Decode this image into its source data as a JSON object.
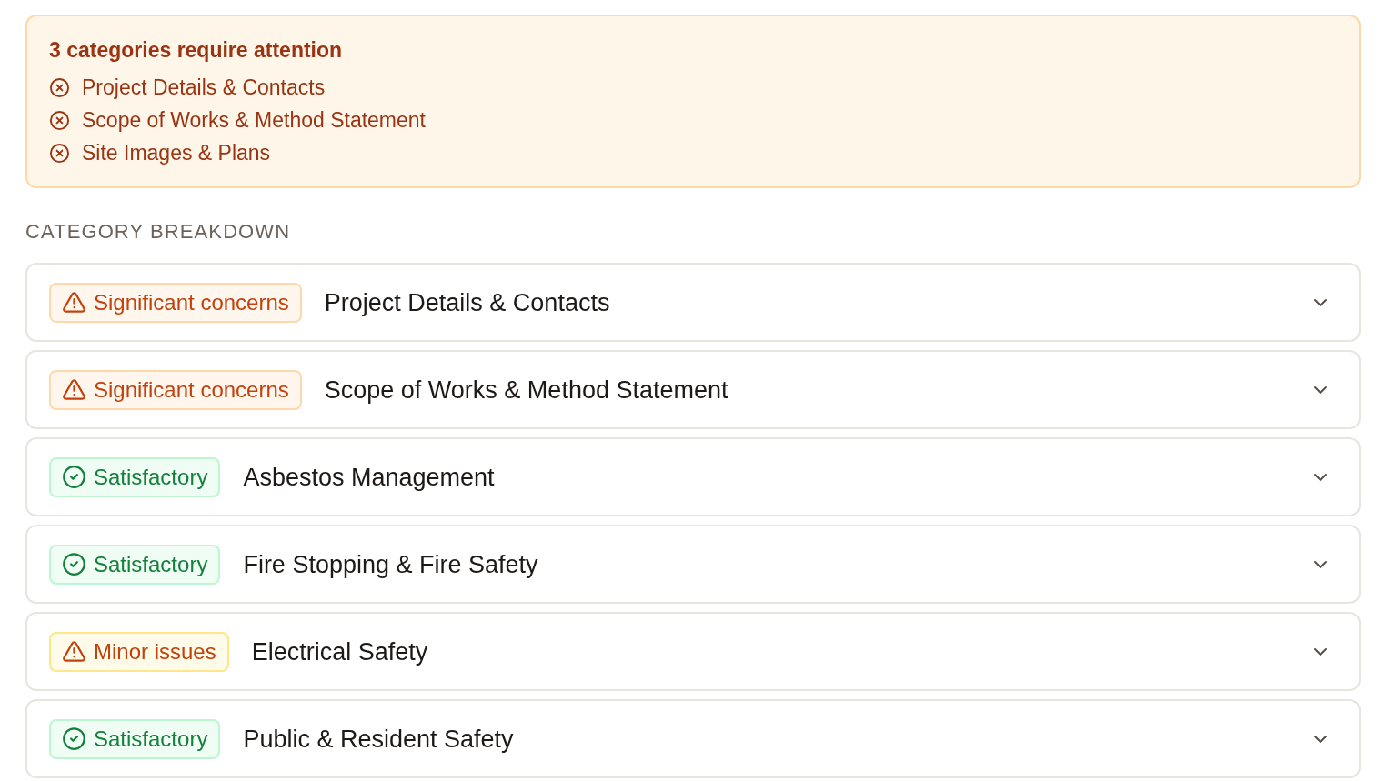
{
  "alert": {
    "title": "3 categories require attention",
    "items": [
      "Project Details & Contacts",
      "Scope of Works & Method Statement",
      "Site Images & Plans"
    ]
  },
  "section_heading": "CATEGORY BREAKDOWN",
  "categories": [
    {
      "status": {
        "kind": "significant",
        "label": "Significant concerns"
      },
      "title": "Project Details & Contacts",
      "expanded": false
    },
    {
      "status": {
        "kind": "significant",
        "label": "Significant concerns"
      },
      "title": "Scope of Works & Method Statement",
      "expanded": false
    },
    {
      "status": {
        "kind": "satisfactory",
        "label": "Satisfactory"
      },
      "title": "Asbestos Management",
      "expanded": false
    },
    {
      "status": {
        "kind": "satisfactory",
        "label": "Satisfactory"
      },
      "title": "Fire Stopping & Fire Safety",
      "expanded": false
    },
    {
      "status": {
        "kind": "minor",
        "label": "Minor issues"
      },
      "title": "Electrical Safety",
      "expanded": false
    },
    {
      "status": {
        "kind": "satisfactory",
        "label": "Satisfactory"
      },
      "title": "Public & Resident Safety",
      "expanded": false
    }
  ]
}
